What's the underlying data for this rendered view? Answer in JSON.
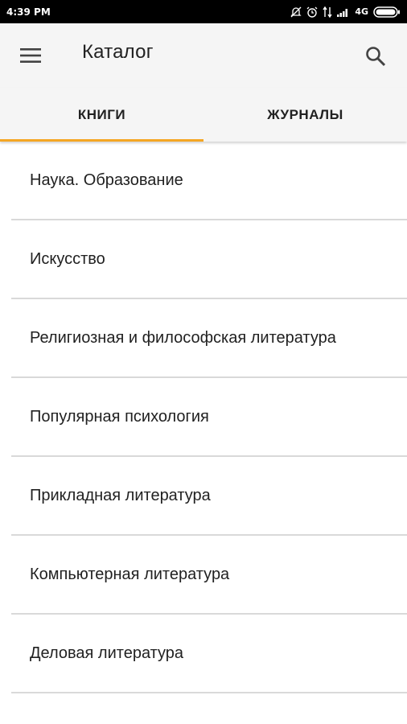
{
  "status_bar": {
    "time": "4:39 PM",
    "network": "4G",
    "icons": [
      "mute-icon",
      "alarm-icon",
      "data-arrows-icon",
      "signal-icon",
      "battery-icon"
    ]
  },
  "app_bar": {
    "title": "Каталог",
    "menu_icon": "hamburger-menu-icon",
    "search_icon": "search-icon"
  },
  "tabs": [
    {
      "label": "КНИГИ",
      "active": true
    },
    {
      "label": "ЖУРНАЛЫ",
      "active": false
    }
  ],
  "accent_color": "#f5a623",
  "categories": [
    {
      "label": "Наука. Образование"
    },
    {
      "label": "Искусство"
    },
    {
      "label": "Религиозная и философская литература"
    },
    {
      "label": "Популярная психология"
    },
    {
      "label": "Прикладная литература"
    },
    {
      "label": "Компьютерная литература"
    },
    {
      "label": "Деловая литература"
    }
  ]
}
